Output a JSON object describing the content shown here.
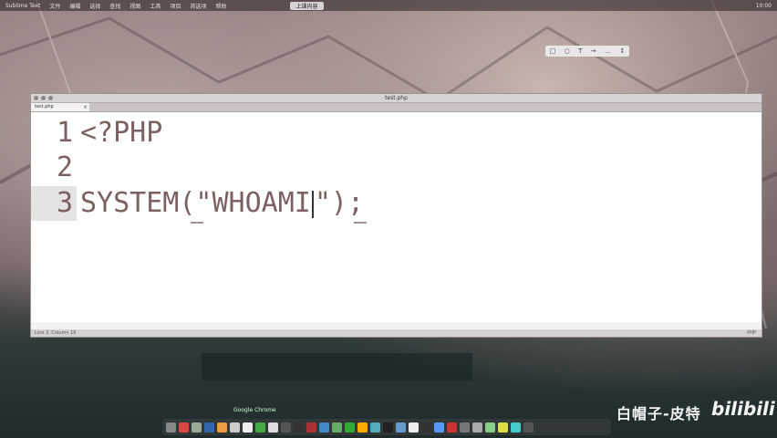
{
  "menubar": {
    "items": [
      "Sublime Text",
      "文件",
      "编辑",
      "选择",
      "查找",
      "视图",
      "工具",
      "项目",
      "首选项",
      "帮助"
    ],
    "center_tab": "上课内容",
    "right_text": "10:00"
  },
  "float_toolbar": {
    "items": [
      "□",
      "○",
      "T",
      "→",
      "…",
      "↕"
    ]
  },
  "window": {
    "title": "test.php",
    "tab_label": "test.php",
    "status_left": "Line 3, Column 16",
    "status_right": "PHP"
  },
  "editor": {
    "lines": [
      {
        "number": "1",
        "text": "<?PHP"
      },
      {
        "number": "2",
        "text": ""
      },
      {
        "number": "3",
        "text_before_caret": "SYSTEM(\"WHOAMI",
        "text_after_caret": "\");"
      }
    ]
  },
  "dock": {
    "label": "Google Chrome",
    "icon_colors": [
      "#888",
      "#d44",
      "#9a9",
      "#36a",
      "#e94",
      "#ccc",
      "#eee",
      "#4a4",
      "#ddd",
      "#555",
      "#333",
      "#a33",
      "#48c",
      "#6a6",
      "#3a3",
      "#fa0",
      "#5ab",
      "#222",
      "#69c",
      "#eee",
      "#333",
      "#59f",
      "#c33",
      "#777",
      "#aaa",
      "#8c8",
      "#dd4",
      "#4cc",
      "#555"
    ]
  },
  "watermark": {
    "text": "白帽子-皮特",
    "logo": "bilibili"
  },
  "colors": {
    "code": "#7d6161",
    "background_editor": "#ffffff"
  }
}
